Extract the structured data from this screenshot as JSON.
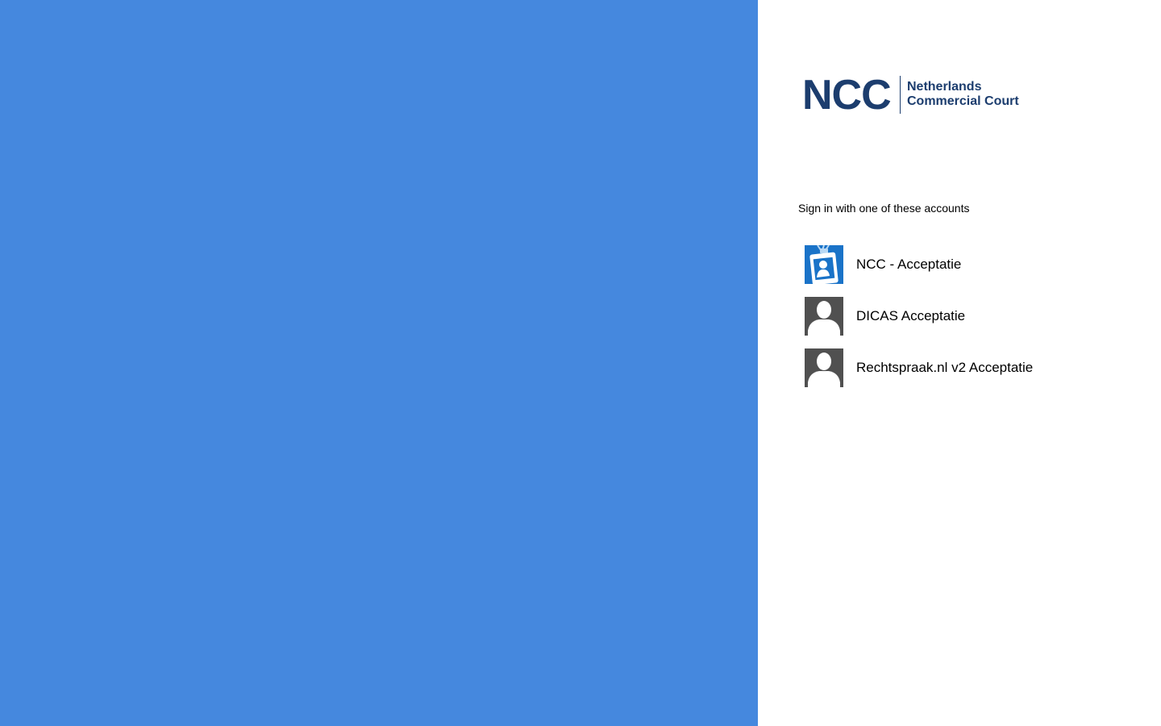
{
  "colors": {
    "illustration_background": "#4588de",
    "brand_navy": "#1c3d6e",
    "badge_icon_blue": "#1a73c8",
    "generic_icon_gray": "#505050"
  },
  "logo": {
    "mark": "NCC",
    "line1": "Netherlands",
    "line2": "Commercial Court"
  },
  "signin": {
    "instruction": "Sign in with one of these accounts",
    "providers": [
      {
        "label": "NCC - Acceptatie",
        "icon": "id-badge-icon"
      },
      {
        "label": "DICAS Acceptatie",
        "icon": "user-silhouette-icon"
      },
      {
        "label": "Rechtspraak.nl v2 Acceptatie",
        "icon": "user-silhouette-icon"
      }
    ]
  }
}
